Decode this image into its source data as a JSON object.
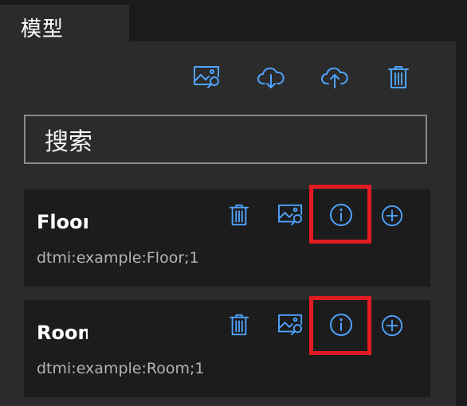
{
  "tab": {
    "label": "模型"
  },
  "toolbar": {
    "icons": [
      "image-search-icon",
      "cloud-download-icon",
      "cloud-upload-icon",
      "trash-icon"
    ]
  },
  "search": {
    "placeholder": "搜索"
  },
  "models": [
    {
      "name": "Floor",
      "id": "dtmi:example:Floor;1"
    },
    {
      "name": "Room",
      "id": "dtmi:example:Room;1"
    }
  ],
  "colors": {
    "accent": "#4fa3ff",
    "highlight": "#e21b23",
    "panel": "#2b2b2b",
    "card": "#1c1c1c"
  }
}
